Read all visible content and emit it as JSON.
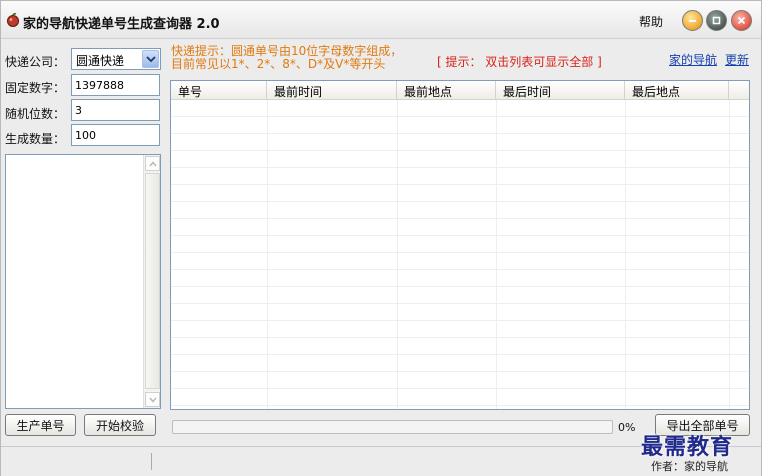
{
  "window": {
    "title": "家的导航快递单号生成查询器 2.0",
    "help_label": "帮助"
  },
  "form": {
    "company_label": "快递公司：",
    "company_value": "圆通快递",
    "fixed_digits_label": "固定数字：",
    "fixed_digits_value": "1397888",
    "random_digits_label": "随机位数：",
    "random_digits_value": "3",
    "count_label": "生成数量：",
    "count_value": "100"
  },
  "hint": {
    "line1": "快递提示：圆通单号由10位字母数字组成，",
    "line2": "目前常见以1*、2*、8*、D*及V*等开头"
  },
  "notice": "[ 提示： 双击列表可显示全部 ]",
  "links": {
    "home": "家的导航",
    "update": "更新"
  },
  "table": {
    "columns": [
      "单号",
      "最前时间",
      "最前地点",
      "最后时间",
      "最后地点"
    ]
  },
  "buttons": {
    "generate": "生产单号",
    "verify": "开始校验",
    "export": "导出全部单号"
  },
  "progress": {
    "value": 0,
    "label": "0%"
  },
  "status": {
    "author": "作者：家的导航"
  },
  "watermark": "最需教育",
  "colors": {
    "hint": "#e07a10",
    "notice": "#d9231b",
    "link": "#1540b0"
  }
}
